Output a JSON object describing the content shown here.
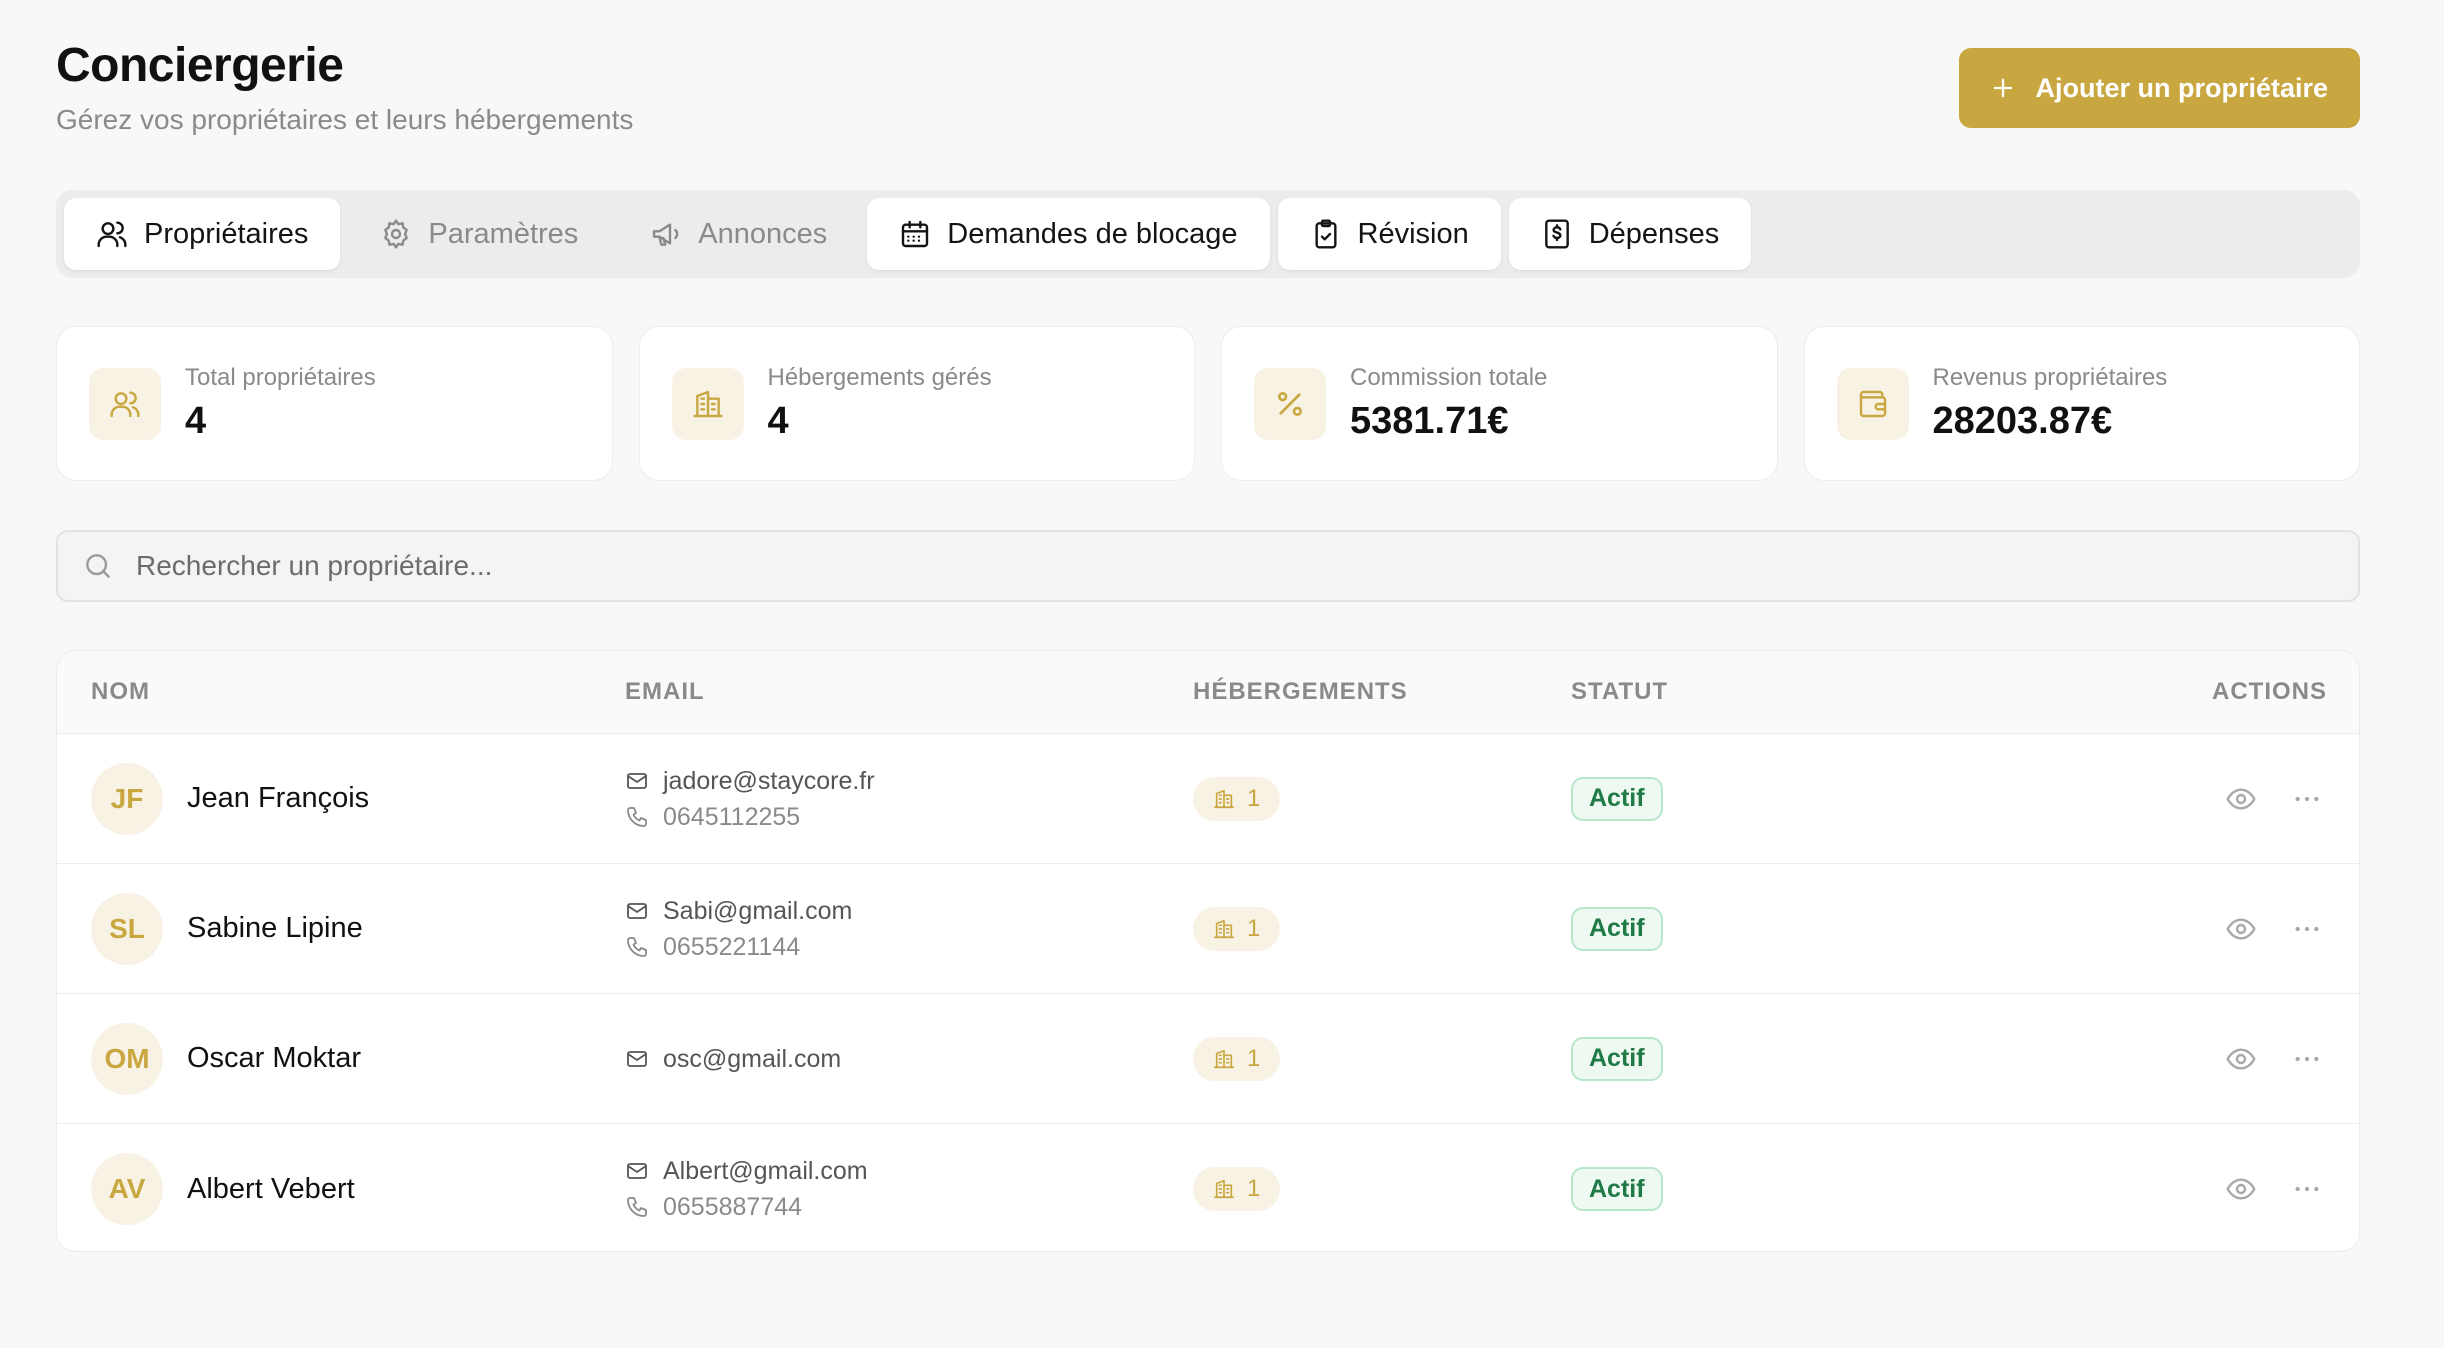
{
  "header": {
    "title": "Conciergerie",
    "subtitle": "Gérez vos propriétaires et leurs hébergements",
    "add_button_label": "Ajouter un propriétaire"
  },
  "tabs": [
    {
      "label": "Propriétaires",
      "icon": "users-icon",
      "active": true
    },
    {
      "label": "Paramètres",
      "icon": "gear-icon",
      "active": false
    },
    {
      "label": "Annonces",
      "icon": "megaphone-icon",
      "active": false
    },
    {
      "label": "Demandes de blocage",
      "icon": "calendar-icon",
      "active": false
    },
    {
      "label": "Révision",
      "icon": "clipboard-check-icon",
      "active": false
    },
    {
      "label": "Dépenses",
      "icon": "receipt-dollar-icon",
      "active": false
    }
  ],
  "stats": [
    {
      "label": "Total propriétaires",
      "value": "4",
      "icon": "users-icon"
    },
    {
      "label": "Hébergements gérés",
      "value": "4",
      "icon": "building-icon"
    },
    {
      "label": "Commission totale",
      "value": "5381.71€",
      "icon": "percent-icon"
    },
    {
      "label": "Revenus propriétaires",
      "value": "28203.87€",
      "icon": "wallet-icon"
    }
  ],
  "search": {
    "placeholder": "Rechercher un propriétaire..."
  },
  "table": {
    "headers": {
      "name": "NOM",
      "email": "EMAIL",
      "hebergements": "HÉBERGEMENTS",
      "status": "STATUT",
      "actions": "ACTIONS"
    },
    "rows": [
      {
        "initials": "JF",
        "name": "Jean François",
        "email": "jadore@staycore.fr",
        "phone": "0645112255",
        "hebergements": "1",
        "status": "Actif"
      },
      {
        "initials": "SL",
        "name": "Sabine Lipine",
        "email": "Sabi@gmail.com",
        "phone": "0655221144",
        "hebergements": "1",
        "status": "Actif"
      },
      {
        "initials": "OM",
        "name": "Oscar Moktar",
        "email": "osc@gmail.com",
        "phone": "",
        "hebergements": "1",
        "status": "Actif"
      },
      {
        "initials": "AV",
        "name": "Albert Vebert",
        "email": "Albert@gmail.com",
        "phone": "0655887744",
        "hebergements": "1",
        "status": "Actif"
      }
    ]
  },
  "colors": {
    "accent": "#c9a740",
    "accent_soft": "#f8f2e4",
    "status_green": "#1f7a45",
    "background": "#f8f8f7"
  }
}
